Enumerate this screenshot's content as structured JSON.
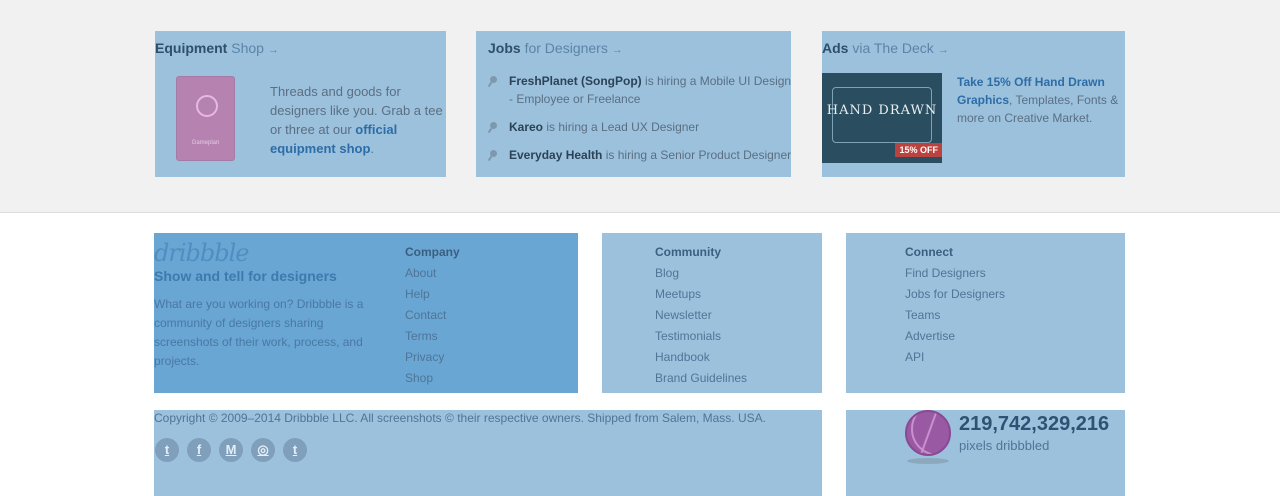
{
  "equipment": {
    "title_strong": "Equipment",
    "title_light": "Shop",
    "arrow": "→",
    "shirt_brand": "Gameplan",
    "text_before": "Threads and goods for designers like you. Grab a tee or three at our ",
    "link": "official equipment shop",
    "text_after": "."
  },
  "jobs": {
    "title_strong": "Jobs",
    "title_light": "for Designers",
    "arrow": "→",
    "items": [
      {
        "company": "FreshPlanet (SongPop)",
        "rest": " is hiring a Mobile UI Design - Employee or Freelance"
      },
      {
        "company": "Kareo",
        "rest": " is hiring a Lead UX Designer"
      },
      {
        "company": "Everyday Health",
        "rest": " is hiring a Senior Product Designer"
      }
    ]
  },
  "ads": {
    "title_strong": "Ads",
    "title_light": "via The Deck",
    "arrow": "→",
    "image_title": "HAND DRAWN",
    "image_badge": "15% OFF",
    "link": "Take 15% Off Hand Drawn Graphics",
    "text_after": ", Templates, Fonts & more on Creative Market."
  },
  "about": {
    "logo": "dribbble",
    "tagline": "Show and tell for designers",
    "description": "What are you working on? Dribbble is a community of designers sharing screenshots of their work, process, and projects."
  },
  "company": {
    "title": "Company",
    "links": [
      "About",
      "Help",
      "Contact",
      "Terms",
      "Privacy",
      "Shop"
    ]
  },
  "community": {
    "title": "Community",
    "links": [
      "Blog",
      "Meetups",
      "Newsletter",
      "Testimonials",
      "Handbook",
      "Brand Guidelines"
    ]
  },
  "connect": {
    "title": "Connect",
    "links": [
      "Find Designers",
      "Jobs for Designers",
      "Teams",
      "Advertise",
      "API"
    ]
  },
  "legal": {
    "copyright": "Copyright © 2009–2014 Dribbble LLC. All screenshots © their respective owners. Shipped from Salem, Mass. USA.",
    "social": [
      {
        "icon": "twitter-icon",
        "glyph": "t"
      },
      {
        "icon": "facebook-icon",
        "glyph": "f"
      },
      {
        "icon": "medium-icon",
        "glyph": "M"
      },
      {
        "icon": "instagram-icon",
        "glyph": "◎"
      },
      {
        "icon": "tumblr-icon",
        "glyph": "t"
      }
    ]
  },
  "counter": {
    "number": "219,742,329,216",
    "label": "pixels dribbbled"
  }
}
